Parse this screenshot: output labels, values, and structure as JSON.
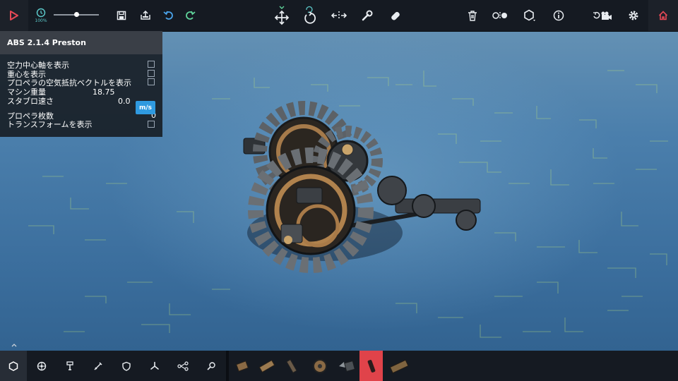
{
  "toolbar": {
    "speed_percent": "100%",
    "slider_value": 0.5,
    "icons": [
      "play-icon",
      "clock-icon",
      "save-icon",
      "load-icon",
      "undo-icon",
      "redo-icon",
      "move-icon",
      "rotate-icon",
      "mirror-icon",
      "wrench-icon",
      "eraser-icon",
      "trash-icon",
      "center-icon",
      "hexagon-icon",
      "info-icon",
      "camera-icon",
      "settings-icon",
      "home-icon"
    ]
  },
  "panel": {
    "title": "ABS 2.1.4 Preston",
    "rows": [
      {
        "label": "空力中心軸を表示"
      },
      {
        "label": "重心を表示"
      },
      {
        "label": "プロペラの空気抵抗ベクトルを表示"
      },
      {
        "label": "マシン重量",
        "value": "18.75"
      },
      {
        "label": "スタブロ速さ",
        "value": "0.0",
        "unit": "m/s"
      },
      {
        "label": "プロペラ枚数",
        "value": "0"
      },
      {
        "label": "トランスフォームを表示"
      }
    ]
  },
  "bottom": {
    "tabs": [
      "blocks-tab",
      "basic-tab",
      "mechanical-tab",
      "weaponry-tab",
      "armour-tab",
      "flight-tab",
      "automation-tab",
      "search-tab"
    ],
    "blocks": [
      "small-wood-block",
      "wooden-pole",
      "metal-brace",
      "wheel-block",
      "spike-block",
      "highlighted-block",
      "ballast-block"
    ],
    "selected_block": "highlighted-block"
  },
  "colors": {
    "bar": "#151a22",
    "accent_blue": "#2f9ae0",
    "selected_red": "#e0434a",
    "play_red": "#e74956",
    "home_red": "#e74956",
    "speed_teal": "#5bc7c8"
  }
}
